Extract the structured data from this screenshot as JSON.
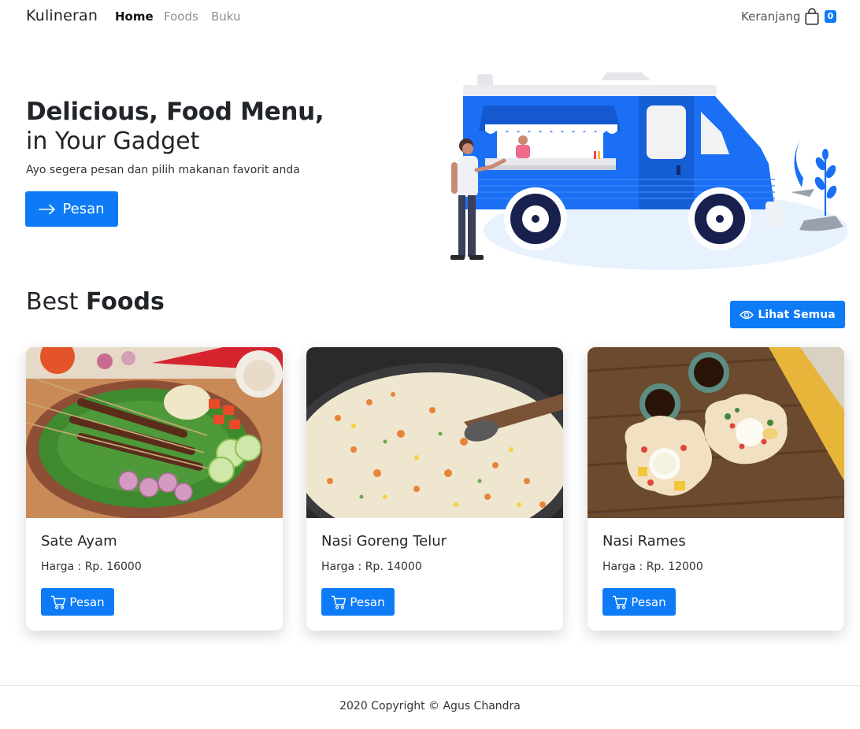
{
  "navbar": {
    "brand": "Kulineran",
    "links": [
      {
        "label": "Home",
        "active": true
      },
      {
        "label": "Foods",
        "active": false
      },
      {
        "label": "Buku",
        "active": false
      }
    ],
    "cart": {
      "label": "Keranjang",
      "count": "0",
      "icon": "shopping-bag-icon"
    }
  },
  "hero": {
    "title": "Delicious, Food Menu,",
    "subtitle": "in Your Gadget",
    "description": "Ayo segera pesan dan pilih makanan favorit anda",
    "button_label": "Pesan",
    "button_icon": "arrow-right-icon",
    "illustration": "food-truck-illustration"
  },
  "best_foods": {
    "title_light": "Best",
    "title_bold": "Foods",
    "see_all_label": "Lihat Semua",
    "see_all_icon": "eye-icon",
    "items": [
      {
        "name": "Sate Ayam",
        "price": "Harga : Rp. 16000",
        "button_label": "Pesan",
        "image": "sate-ayam-photo"
      },
      {
        "name": "Nasi Goreng Telur",
        "price": "Harga : Rp. 14000",
        "button_label": "Pesan",
        "image": "nasi-goreng-photo"
      },
      {
        "name": "Nasi Rames",
        "price": "Harga : Rp. 12000",
        "button_label": "Pesan",
        "image": "nasi-rames-photo"
      }
    ]
  },
  "footer": {
    "text": "2020 Copyright © Agus Chandra"
  },
  "colors": {
    "primary": "#0d7bf6",
    "text": "#212529",
    "muted": "#8a8f94"
  }
}
